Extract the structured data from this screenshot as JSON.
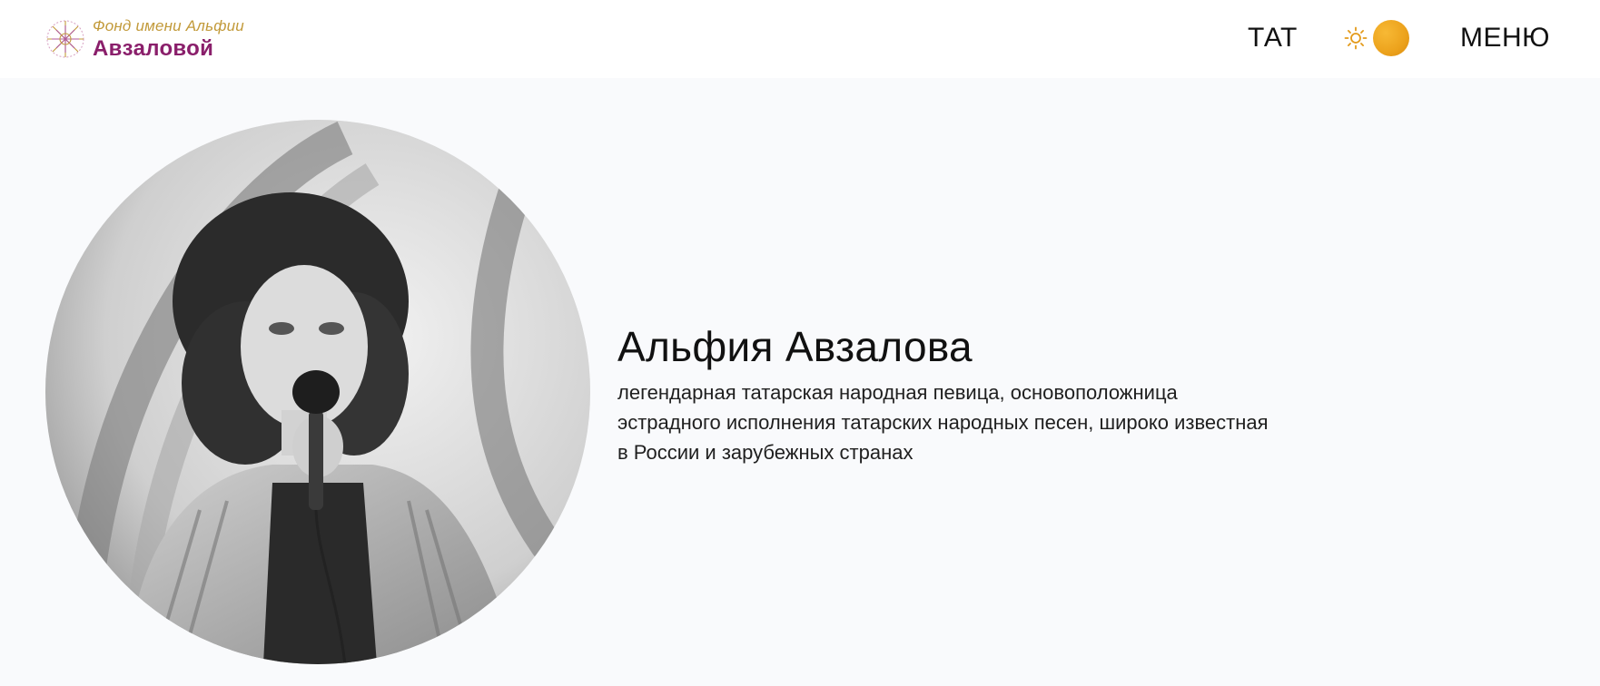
{
  "header": {
    "logo": {
      "line1": "Фонд имени Альфии",
      "line2": "Авзаловой",
      "icon": "sunburst-logo-icon"
    },
    "lang_label": "ТАТ",
    "theme_toggle": {
      "icon": "sun-icon",
      "knob_color": "#eca21c"
    },
    "menu_label": "МЕНЮ"
  },
  "hero": {
    "title": "Альфия Авзалова",
    "description": "легендарная татарская народная певица, основоположница эстрадного исполнения татарских народных песен, широко известная в России и зарубежных странах",
    "portrait": "black-and-white photo of singer with microphone"
  },
  "colors": {
    "logo_gold": "#c29a3a",
    "logo_purple": "#8a1f6b",
    "accent_orange": "#eca21c",
    "hero_background": "#f9fafc"
  }
}
